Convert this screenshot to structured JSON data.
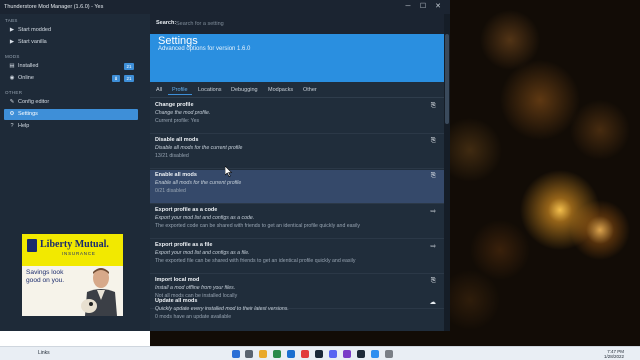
{
  "window": {
    "title": "Thunderstore Mod Manager (1.6.0) - Yes",
    "controls": {
      "minimize": "─",
      "maximize": "☐",
      "close": "✕"
    }
  },
  "sidebar": {
    "sections": {
      "tabs": "TABS",
      "mods": "MODS",
      "other": "OTHER"
    },
    "items": [
      {
        "label": "Start modded",
        "icon": "play-icon",
        "glyph": "▶"
      },
      {
        "label": "Start vanilla",
        "icon": "play-icon",
        "glyph": "▶"
      },
      {
        "label": "Installed",
        "icon": "folder-icon",
        "glyph": "▤",
        "badge": "21"
      },
      {
        "label": "Online",
        "icon": "globe-icon",
        "glyph": "◉",
        "badge": "21",
        "download_glyph": "⬇"
      },
      {
        "label": "Config editor",
        "icon": "wrench-icon",
        "glyph": "✎"
      },
      {
        "label": "Settings",
        "icon": "gear-icon",
        "glyph": "⚙"
      },
      {
        "label": "Help",
        "icon": "help-icon",
        "glyph": "?"
      }
    ]
  },
  "search": {
    "label": "Search:",
    "placeholder": "Search for a setting"
  },
  "hero": {
    "title": "Settings",
    "subtitle": "Advanced options for version 1.6.0"
  },
  "tabs": [
    "All",
    "Profile",
    "Locations",
    "Debugging",
    "Modpacks",
    "Other"
  ],
  "active_tab": "Profile",
  "settings": [
    {
      "title": "Change profile",
      "description": "Change the mod profile.",
      "value": "Current profile: Yes",
      "icon": "file-icon",
      "glyph": "⎘"
    },
    {
      "title": "Disable all mods",
      "description": "Disable all mods for the current profile",
      "value": "13/21 disabled",
      "icon": "file-icon",
      "glyph": "⎘"
    },
    {
      "title": "Enable all mods",
      "description": "Enable all mods for the current profile",
      "value": "0/21 disabled",
      "icon": "file-icon",
      "glyph": "⎘"
    },
    {
      "title": "Export profile as a code",
      "description": "Export your mod list and configs as a code.",
      "value": "The exported code can be shared with friends to get an identical profile quickly and easily",
      "icon": "file-export-icon",
      "glyph": "⇨"
    },
    {
      "title": "Export profile as a file",
      "description": "Export your mod list and configs as a file.",
      "value": "The exported file can be shared with friends to get an identical profile quickly and easily",
      "icon": "file-export-icon",
      "glyph": "⇨"
    },
    {
      "title": "Import local mod",
      "description": "Install a mod offline from your files.",
      "value": "Not all mods can be installed locally",
      "icon": "file-import-icon",
      "glyph": "⎘"
    },
    {
      "title": "Update all mods",
      "description": "Quickly update every installed mod to their latest versions.",
      "value": "0 mods have an update available",
      "icon": "cloud-upload-icon",
      "glyph": "☁"
    }
  ],
  "ad": {
    "brand": "Liberty Mutual.",
    "subbrand": "INSURANCE",
    "headline": "Savings look good on you."
  },
  "taskbar": {
    "links_label": "Links",
    "time": "7:47 PM",
    "date": "1/28/2022"
  }
}
